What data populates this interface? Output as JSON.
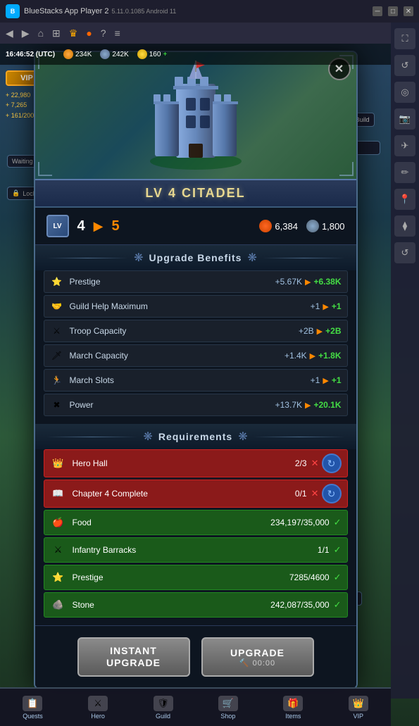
{
  "app": {
    "title": "BlueStacks App Player 2",
    "version": "5.11.0.1085 Android 11"
  },
  "game": {
    "time": "16:46:52 (UTC)",
    "resources": {
      "currency1": "234K",
      "currency2": "242K",
      "gold": "160",
      "player_stats": {
        "score1": "22,980",
        "score2": "7,265",
        "capacity": "161/200"
      }
    }
  },
  "dialog": {
    "title": "LV 4 CITADEL",
    "close_label": "✕",
    "level": {
      "lv_label": "LV",
      "current": "4",
      "arrow": "▶",
      "next": "5",
      "cost_food": "6,384",
      "cost_stone": "1,800"
    },
    "benefits_header": "Upgrade Benefits",
    "benefits": [
      {
        "icon": "⭐",
        "name": "Prestige",
        "current": "+5.67K",
        "arrow": "▶",
        "next": "+6.38K"
      },
      {
        "icon": "🤝",
        "name": "Guild Help Maximum",
        "current": "+1",
        "arrow": "▶",
        "next": "+1"
      },
      {
        "icon": "⚔️",
        "name": "Troop Capacity",
        "current": "+2B",
        "arrow": "▶",
        "next": "+2B"
      },
      {
        "icon": "🗡️",
        "name": "March Capacity",
        "current": "+1.4K",
        "arrow": "▶",
        "next": "+1.8K"
      },
      {
        "icon": "🏃",
        "name": "March Slots",
        "current": "+1",
        "arrow": "▶",
        "next": "+1"
      },
      {
        "icon": "✖",
        "name": "Power",
        "current": "+13.7K",
        "arrow": "▶",
        "next": "+20.1K"
      }
    ],
    "requirements_header": "Requirements",
    "requirements": [
      {
        "icon": "👑",
        "name": "Hero Hall",
        "value": "2/3",
        "status": "fail",
        "has_refresh": true
      },
      {
        "icon": "📖",
        "name": "Chapter 4 Complete",
        "value": "0/1",
        "status": "fail",
        "has_refresh": true
      },
      {
        "icon": "🍎",
        "name": "Food",
        "value": "234,197/35,000",
        "status": "pass",
        "has_refresh": false
      },
      {
        "icon": "⚔",
        "name": "Infantry Barracks",
        "value": "1/1",
        "status": "pass",
        "has_refresh": false
      },
      {
        "icon": "⭐",
        "name": "Prestige",
        "value": "7285/4600",
        "status": "pass",
        "has_refresh": false
      },
      {
        "icon": "🪨",
        "name": "Stone",
        "value": "242,087/35,000",
        "status": "pass",
        "has_refresh": false
      }
    ],
    "buttons": {
      "instant_upgrade": "INSTANT\nUPGRADE",
      "upgrade": "UPGRADE",
      "upgrade_time": "🔨 00:00"
    }
  },
  "bottom_nav": [
    {
      "label": "Quests",
      "icon": "📋"
    },
    {
      "label": "Hero",
      "icon": "⚔️"
    },
    {
      "label": "Guild",
      "icon": "🛡️"
    },
    {
      "label": "Shop",
      "icon": "🛒"
    },
    {
      "label": "Items",
      "icon": "🎁"
    },
    {
      "label": "VIP",
      "icon": "👑"
    }
  ],
  "right_sidebar": {
    "icons": [
      "⛶",
      "↺",
      "◉",
      "📷",
      "✈",
      "✏",
      "📍",
      "⧫",
      "↺"
    ]
  },
  "colors": {
    "accent_orange": "#ff8800",
    "accent_green": "#44dd44",
    "accent_red": "#ff4444",
    "fail_bg": "#8b1a1a",
    "pass_bg": "#1a5a1a",
    "title_gold": "#e8d890",
    "dialog_border": "#4a6a8a"
  }
}
